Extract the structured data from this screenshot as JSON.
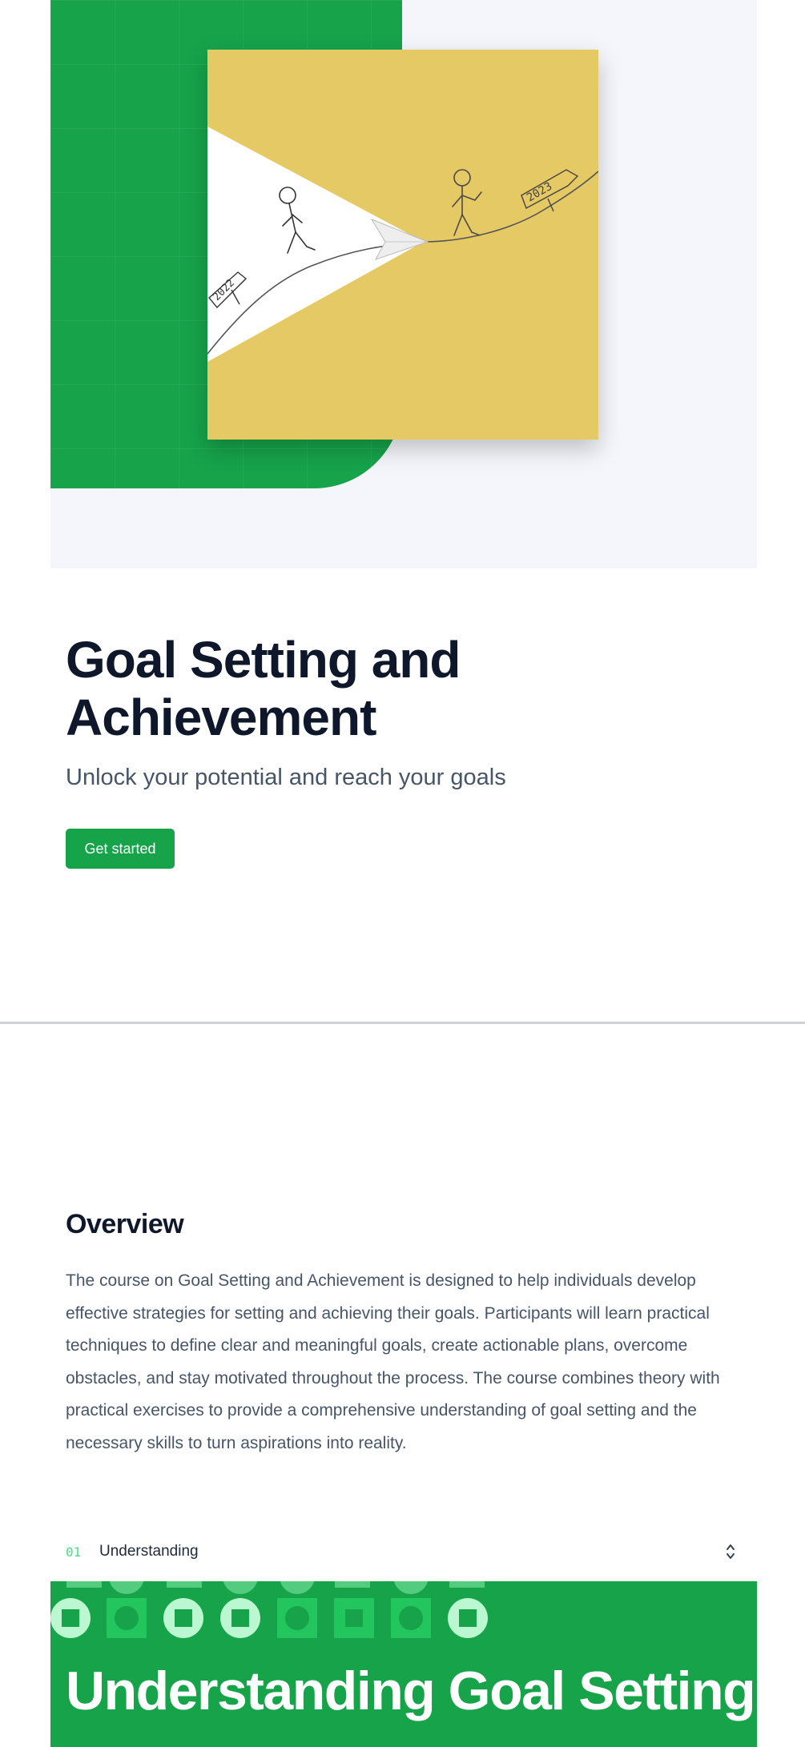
{
  "hero": {
    "illustration": {
      "sign_left": "2022",
      "sign_right": "2023",
      "colors": {
        "green": "#16a34a",
        "card": "#e5c964",
        "background": "#f4f6fb"
      }
    },
    "title": "Goal Setting and Achievement",
    "subtitle": "Unlock your potential and reach your goals",
    "cta_label": "Get started"
  },
  "overview": {
    "title": "Overview",
    "body": "The course on Goal Setting and Achievement is designed to help individuals develop effective strategies for setting and achieving their goals. Participants will learn practical techniques to define clear and meaningful goals, create actionable plans, overcome obstacles, and stay motivated throughout the process. The course combines theory with practical exercises to provide a comprehensive understanding of goal setting and the necessary skills to turn aspirations into reality."
  },
  "modules": [
    {
      "number": "01",
      "label": "Understanding",
      "icon": "chevron-up-down-icon"
    }
  ],
  "module_banner": {
    "title": "Understanding Goal Setting",
    "color": "#16a34a"
  }
}
